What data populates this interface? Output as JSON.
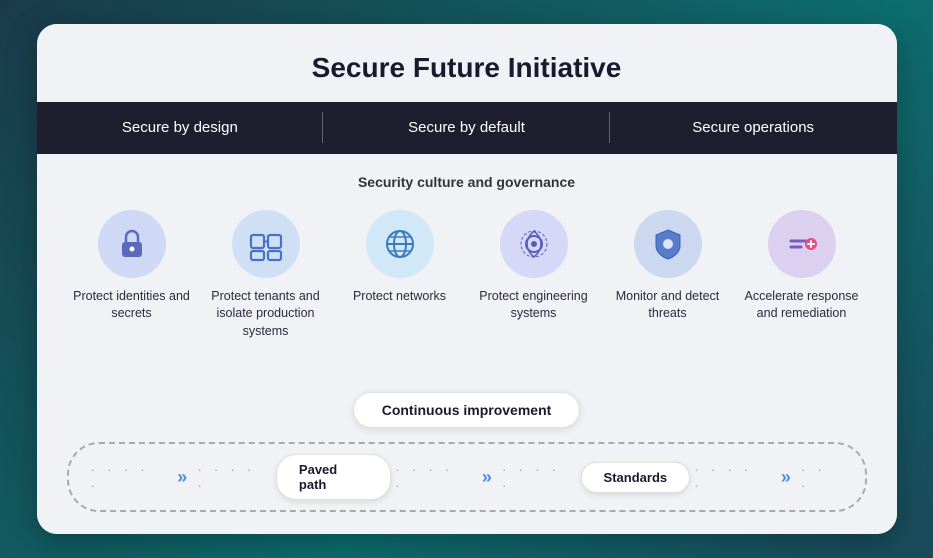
{
  "title": "Secure Future Initiative",
  "header": {
    "sections": [
      {
        "label": "Secure by design"
      },
      {
        "label": "Secure by default"
      },
      {
        "label": "Secure operations"
      }
    ]
  },
  "governance": {
    "label": "Security culture and governance"
  },
  "icons": [
    {
      "id": "identities",
      "label": "Protect identities and secrets",
      "color": "#cfd9f5"
    },
    {
      "id": "tenants",
      "label": "Protect tenants and isolate production systems",
      "color": "#cfe0f5"
    },
    {
      "id": "networks",
      "label": "Protect networks",
      "color": "#d0e8f7"
    },
    {
      "id": "engineering",
      "label": "Protect engineering systems",
      "color": "#d5d8f7"
    },
    {
      "id": "monitor",
      "label": "Monitor and detect threats",
      "color": "#ccd8f0"
    },
    {
      "id": "accelerate",
      "label": "Accelerate response and remediation",
      "color": "#dcd0f0"
    }
  ],
  "bottom": {
    "continuous_label": "Continuous improvement",
    "paved_path_label": "Paved path",
    "standards_label": "Standards"
  }
}
